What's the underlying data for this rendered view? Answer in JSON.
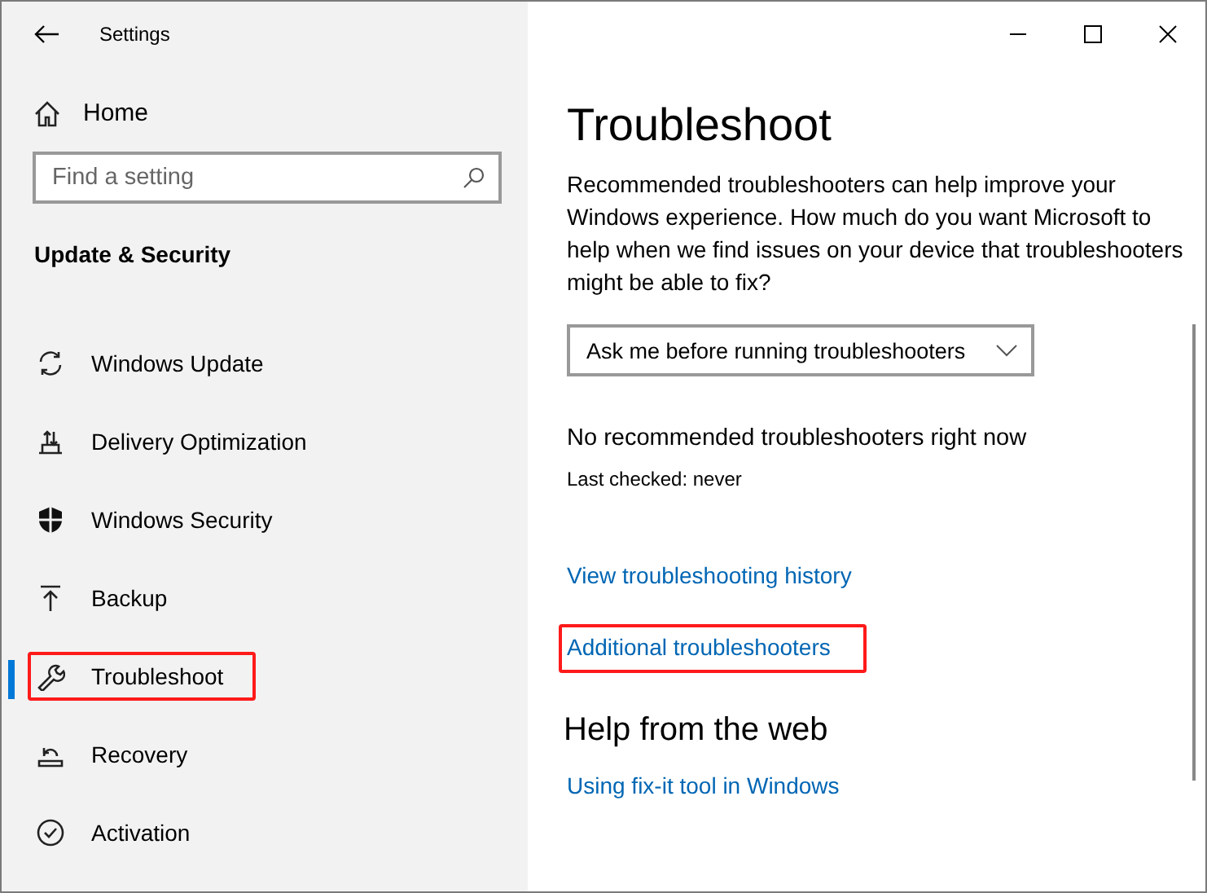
{
  "window": {
    "title": "Settings"
  },
  "sidebar": {
    "home": "Home",
    "search": {
      "placeholder": "Find a setting"
    },
    "section": "Update & Security",
    "items": [
      {
        "label": "Windows Update",
        "selected": false,
        "highlighted": false
      },
      {
        "label": "Delivery Optimization",
        "selected": false,
        "highlighted": false
      },
      {
        "label": "Windows Security",
        "selected": false,
        "highlighted": false
      },
      {
        "label": "Backup",
        "selected": false,
        "highlighted": false
      },
      {
        "label": "Troubleshoot",
        "selected": true,
        "highlighted": true
      },
      {
        "label": "Recovery",
        "selected": false,
        "highlighted": false
      },
      {
        "label": "Activation",
        "selected": false,
        "highlighted": false
      }
    ]
  },
  "content": {
    "title": "Troubleshoot",
    "description": "Recommended troubleshooters can help improve your Windows experience. How much do you want Microsoft to help when we find issues on your device that troubleshooters might be able to fix?",
    "dropdown": {
      "value": "Ask me before running troubleshooters"
    },
    "status": "No recommended troubleshooters right now",
    "last_checked": "Last checked: never",
    "links": [
      {
        "label": "View troubleshooting history",
        "highlighted": false
      },
      {
        "label": "Additional troubleshooters",
        "highlighted": true
      }
    ],
    "help_heading": "Help from the web",
    "help_links": [
      {
        "label": "Using fix-it tool in Windows"
      }
    ]
  }
}
